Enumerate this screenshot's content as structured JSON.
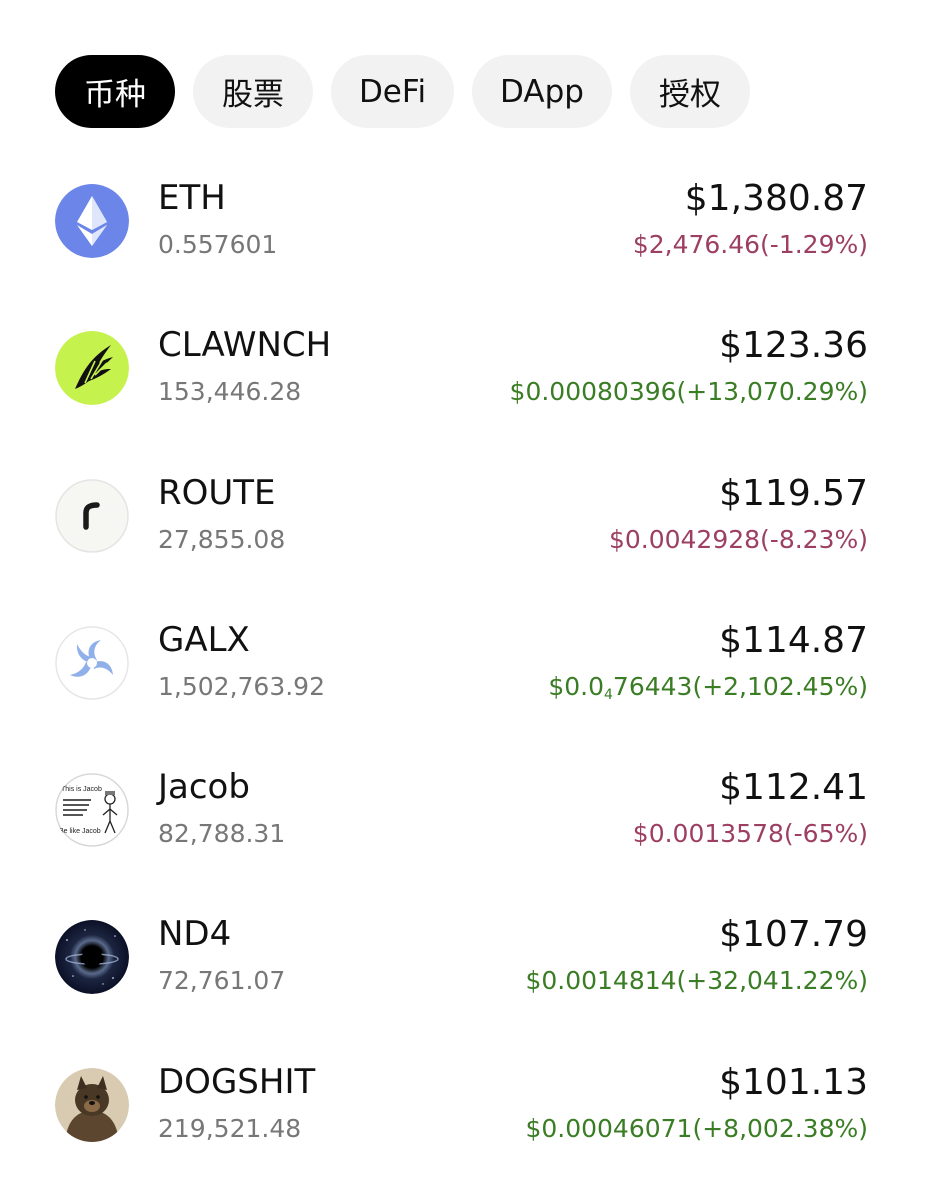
{
  "tabs": [
    {
      "label": "币种",
      "active": true
    },
    {
      "label": "股票",
      "active": false
    },
    {
      "label": "DeFi",
      "active": false
    },
    {
      "label": "DApp",
      "active": false
    },
    {
      "label": "授权",
      "active": false
    }
  ],
  "tokens": [
    {
      "name": "ETH",
      "amount": "0.557601",
      "value": "$1,380.87",
      "price": "$2,476.46(-1.29%)",
      "trend": "down",
      "icon": "ethereum-icon"
    },
    {
      "name": "CLAWNCH",
      "amount": "153,446.28",
      "value": "$123.36",
      "price": "$0.00080396(+13,070.29%)",
      "trend": "up",
      "icon": "wing-icon"
    },
    {
      "name": "ROUTE",
      "amount": "27,855.08",
      "value": "$119.57",
      "price": "$0.0042928(-8.23%)",
      "trend": "down",
      "icon": "route-r-icon"
    },
    {
      "name": "GALX",
      "amount": "1,502,763.92",
      "value": "$114.87",
      "price_prefix": "$0.0",
      "price_sub": "4",
      "price_rest": "76443(+2,102.45%)",
      "trend": "up",
      "icon": "galxe-swirl-icon"
    },
    {
      "name": "Jacob",
      "amount": "82,788.31",
      "value": "$112.41",
      "price": "$0.0013578(-65%)",
      "trend": "down",
      "icon": "jacob-meme-icon",
      "icon_text": [
        "This is Jacob",
        "Be like Jacob"
      ]
    },
    {
      "name": "ND4",
      "amount": "72,761.07",
      "value": "$107.79",
      "price": "$0.0014814(+32,041.22%)",
      "trend": "up",
      "icon": "black-hole-icon"
    },
    {
      "name": "DOGSHIT",
      "amount": "219,521.48",
      "value": "$101.13",
      "price": "$0.00046071(+8,002.38%)",
      "trend": "up",
      "icon": "dog-photo-icon"
    }
  ]
}
